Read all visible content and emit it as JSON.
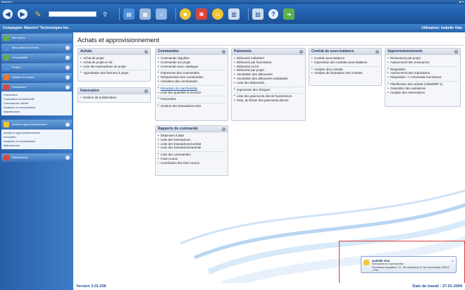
{
  "window": {
    "title": "Maestro*",
    "controls": "_ ■ ✕"
  },
  "toolbar": {
    "icons": [
      "back-icon",
      "forward-icon",
      "broom-icon",
      "search-input",
      "binoculars-icon",
      "report-icon",
      "calculator-icon",
      "home-icon",
      "calendar-icon",
      "users-icon",
      "document-icon",
      "chart-icon",
      "help-icon",
      "exit-icon"
    ]
  },
  "companybar": {
    "company": "Compagnie: Maestro* Technologies Inc.",
    "user": "Utilisateur: Isabelle Viau"
  },
  "sidebar": {
    "items": [
      {
        "label": "Mon Menu",
        "color": "#5fb04c"
      },
      {
        "label": "Mes options récentes",
        "color": "#4d8ed8"
      },
      {
        "label": "Comptabilité",
        "color": "#5fb04c"
      },
      {
        "label": "Projets",
        "color": "#4d8ed8"
      },
      {
        "label": "Gestion du temps",
        "color": "#e77a2a"
      },
      {
        "label": "Facturation",
        "color": "#d9463c"
      }
    ],
    "facturation_sub": [
      "Facturation",
      "Facturation contractuelle",
      "Commandes clients",
      "Analyses et consultations",
      "Maintenance"
    ],
    "achats_item": {
      "label": "Achat et approvisionnement",
      "color": "#f2c531"
    },
    "achats_sub": [
      "Achats et approvisionnement",
      "Inventaire",
      "Analyses et consultations",
      "Maintenance"
    ],
    "maintenance_item": {
      "label": "Maintenance",
      "color": "#d9463c"
    }
  },
  "main": {
    "title": "Achats et approvisionnement",
    "panels": {
      "achats": {
        "title": "Achats",
        "items": [
          "Achat de projet",
          "Achat de projet en lot",
          "Liste des transactions de projet",
          "Approbation des factures à payer"
        ]
      },
      "fabrication": {
        "title": "Fabrication",
        "items": [
          "Gestion de la fabrication"
        ]
      },
      "commandes": {
        "title": "Commandes",
        "items": [
          "Commande régulière",
          "Commande sur projet",
          "Commande avec catalogue",
          "Impression des commandes",
          "Réimpression des commandes",
          "Activation des commandes",
          "Réception de marchandise",
          "Liste des quantités à recevoir",
          "Facturation",
          "Gestion des transactions EDI"
        ]
      },
      "paiements": {
        "title": "Paiements",
        "items": [
          "Déboursé individuel",
          "Déboursé par fournisseur",
          "Déboursé en lot",
          "Déboursé par projet",
          "Annulation des déboursés",
          "Annulation des déboursés individuels",
          "Liste des déboursés",
          "Impression des chèques",
          "Liste des paiements directs fournisseurs",
          "Prép. du fichier des paiements directs"
        ]
      },
      "contrat": {
        "title": "Contrat de sous-traitance",
        "items": [
          "Contrat sous-traitance",
          "Impression des contrats sous-traitance",
          "Analyse des contrats",
          "Analyse de facturation des contrats"
        ]
      },
      "approvisionnements": {
        "title": "Approvisionnements",
        "items": [
          "Ressources par projet",
          "Avancement des ressources",
          "Réquisition",
          "Avancement des réquisitions",
          "Réquisition -> commande fournisseur",
          "Planification des achats (CBN/MRP 1)",
          "Calendrier des opérations",
          "Analyse des réservations"
        ]
      },
      "rapports": {
        "title": "Rapports de commande",
        "items": [
          "Dépenses à date",
          "Liste des transactions",
          "Liste des transactions/contrat",
          "Liste des transactions/activité",
          "Liste des commandes",
          "Frais courus",
          "Conciliation des frais courus"
        ]
      }
    }
  },
  "notification": {
    "name": "Isabelle Viau",
    "subject": "Réception de marchandise",
    "message": "Prochaine réquisition: 27, No réquisition 8, No commande: 90012 - Prix"
  },
  "footer": {
    "version": "Version 3.01.026",
    "date": "Date de travail : 27-01-2009"
  }
}
